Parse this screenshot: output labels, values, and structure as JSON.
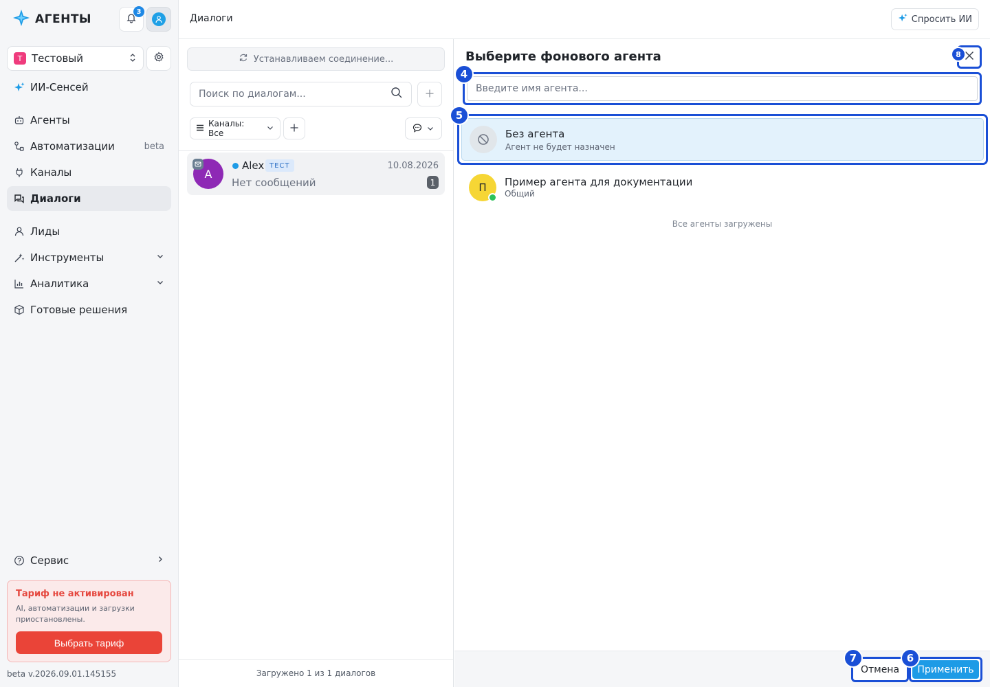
{
  "brand": {
    "name": "АГЕНТЫ"
  },
  "notifications": {
    "count": "3"
  },
  "workspace": {
    "badge": "Т",
    "name": "Тестовый"
  },
  "sidebar": {
    "items": [
      {
        "label": "ИИ-Сенсей",
        "icon": "sparkle-icon"
      },
      {
        "label": "Агенты",
        "icon": "robot-icon"
      },
      {
        "label": "Автоматизации",
        "icon": "workflow-icon",
        "trail": "beta"
      },
      {
        "label": "Каналы",
        "icon": "plug-icon"
      },
      {
        "label": "Диалоги",
        "icon": "chat-icon",
        "active": true
      },
      {
        "label": "Лиды",
        "icon": "user-icon"
      },
      {
        "label": "Инструменты",
        "icon": "tools-icon"
      },
      {
        "label": "Аналитика",
        "icon": "bar-chart-icon"
      },
      {
        "label": "Готовые решения",
        "icon": "box-icon"
      },
      {
        "label": "Сервис",
        "icon": "help-icon"
      }
    ],
    "tariff": {
      "title": "Тариф не активирован",
      "desc": "AI, автоматизации и загрузки приостановлены.",
      "button": "Выбрать тариф"
    },
    "version": "beta v.2026.09.01.145155"
  },
  "header": {
    "title": "Диалоги",
    "ask_ai": "Спросить ИИ"
  },
  "dialogs": {
    "connection": "Устанавливаем соединение...",
    "search_placeholder": "Поиск по диалогам...",
    "channels_filter": "Каналы: Все",
    "items": [
      {
        "avatar": "A",
        "name": "Alex",
        "tag": "ТЕСТ",
        "date": "10.08.2026",
        "preview": "Нет сообщений",
        "unread": "1"
      }
    ],
    "footer": "Загружено 1 из 1 диалогов"
  },
  "agent_panel": {
    "title": "Выберите фонового агента",
    "search_placeholder": "Введите имя агента...",
    "options": [
      {
        "title": "Без агента",
        "subtitle": "Агент не будет назначен"
      },
      {
        "avatar": "П",
        "title": "Пример агента для документации",
        "subtitle": "Общий"
      }
    ],
    "all_loaded": "Все агенты загружены",
    "cancel": "Отмена",
    "apply": "Применить"
  },
  "markers": {
    "m4": "4",
    "m5": "5",
    "m6": "6",
    "m7": "7",
    "m8": "8"
  },
  "colors": {
    "accent": "#1d9be6",
    "highlight": "#1a4fd6",
    "danger": "#ea4438"
  }
}
